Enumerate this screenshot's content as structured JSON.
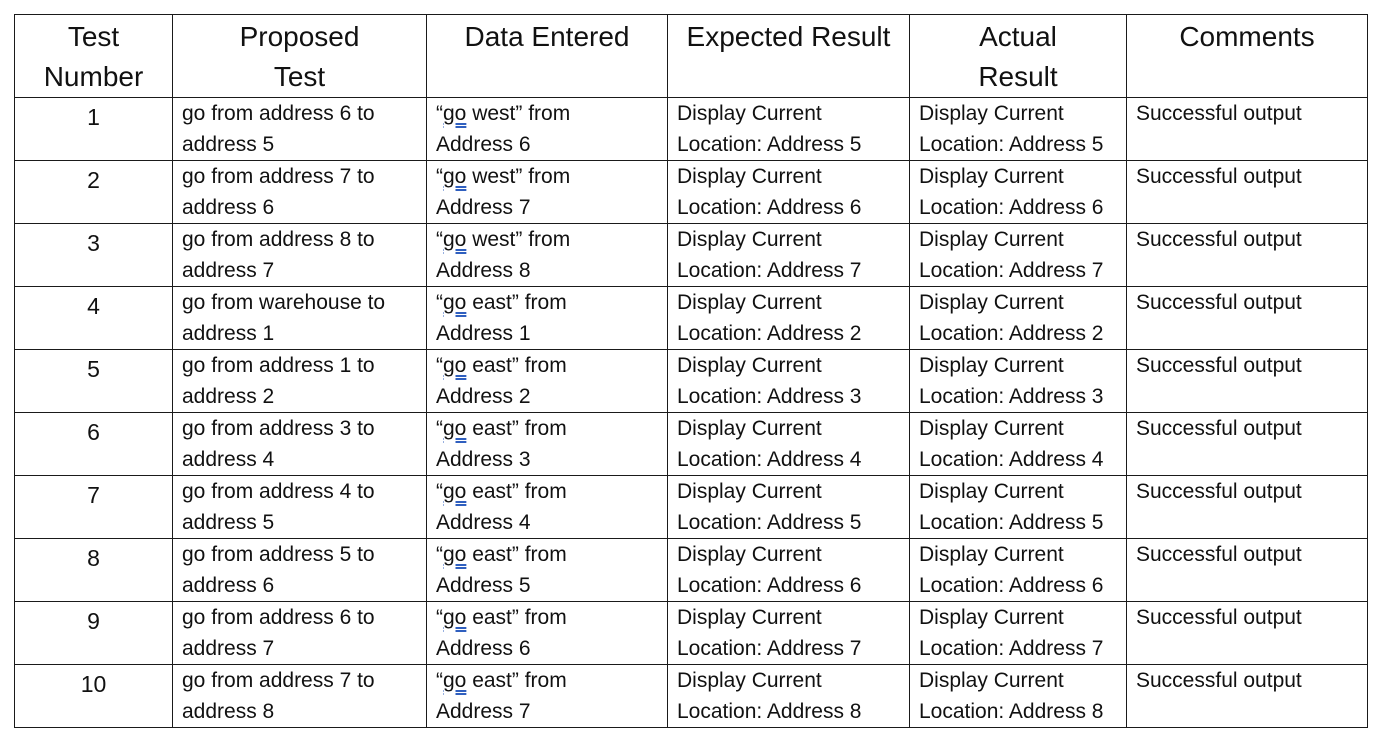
{
  "headers": {
    "test_number": [
      "Test",
      "Number"
    ],
    "proposed_test": [
      "Proposed",
      "Test"
    ],
    "data_entered": [
      "Data Entered"
    ],
    "expected_result": [
      "Expected Result"
    ],
    "actual_result": [
      "Actual",
      "Result"
    ],
    "comments": [
      "Comments"
    ]
  },
  "rows": [
    {
      "number": "1",
      "proposed": [
        "go from address 6 to",
        "address 5"
      ],
      "data": {
        "open": "“",
        "go": "go",
        "rest": " west” from",
        "line2": "Address 6"
      },
      "expected": [
        "Display Current",
        "Location: Address 5"
      ],
      "actual": [
        "Display Current",
        "Location: Address 5"
      ],
      "comment": "Successful output"
    },
    {
      "number": "2",
      "proposed": [
        "go from address 7 to",
        "address 6"
      ],
      "data": {
        "open": "“",
        "go": "go",
        "rest": " west” from",
        "line2": "Address 7"
      },
      "expected": [
        "Display Current",
        "Location: Address 6"
      ],
      "actual": [
        "Display Current",
        "Location: Address 6"
      ],
      "comment": "Successful output"
    },
    {
      "number": "3",
      "proposed": [
        "go from address 8 to",
        "address 7"
      ],
      "data": {
        "open": "“",
        "go": "go",
        "rest": " west” from",
        "line2": "Address 8"
      },
      "expected": [
        "Display Current",
        "Location: Address 7"
      ],
      "actual": [
        "Display Current",
        "Location: Address 7"
      ],
      "comment": "Successful output"
    },
    {
      "number": "4",
      "proposed": [
        "go from warehouse to",
        "address 1"
      ],
      "data": {
        "open": "“",
        "go": "go",
        "rest": " east” from",
        "line2": "Address 1"
      },
      "expected": [
        "Display Current",
        "Location: Address 2"
      ],
      "actual": [
        "Display Current",
        "Location: Address 2"
      ],
      "comment": "Successful output"
    },
    {
      "number": "5",
      "proposed": [
        "go from address 1 to",
        "address 2"
      ],
      "data": {
        "open": "“",
        "go": "go",
        "rest": " east” from",
        "line2": "Address 2"
      },
      "expected": [
        "Display Current",
        "Location: Address 3"
      ],
      "actual": [
        "Display Current",
        "Location: Address 3"
      ],
      "comment": "Successful output"
    },
    {
      "number": "6",
      "proposed": [
        "go from address 3 to",
        "address 4"
      ],
      "data": {
        "open": "“",
        "go": "go",
        "rest": " east” from",
        "line2": "Address 3"
      },
      "expected": [
        "Display Current",
        "Location: Address 4"
      ],
      "actual": [
        "Display Current",
        "Location: Address 4"
      ],
      "comment": "Successful output"
    },
    {
      "number": "7",
      "proposed": [
        "go from address 4 to",
        "address 5"
      ],
      "data": {
        "open": "“",
        "go": "go",
        "rest": " east” from",
        "line2": "Address 4"
      },
      "expected": [
        "Display Current",
        "Location: Address 5"
      ],
      "actual": [
        "Display Current",
        "Location: Address 5"
      ],
      "comment": "Successful output"
    },
    {
      "number": "8",
      "proposed": [
        "go from address 5 to",
        "address 6"
      ],
      "data": {
        "open": "“",
        "go": "go",
        "rest": " east” from",
        "line2": "Address 5"
      },
      "expected": [
        "Display Current",
        "Location: Address 6"
      ],
      "actual": [
        "Display Current",
        "Location: Address 6"
      ],
      "comment": "Successful output"
    },
    {
      "number": "9",
      "proposed": [
        "go from address 6 to",
        "address 7"
      ],
      "data": {
        "open": "“",
        "go": "go",
        "rest": " east” from",
        "line2": "Address 6"
      },
      "expected": [
        "Display Current",
        "Location: Address 7"
      ],
      "actual": [
        "Display Current",
        "Location: Address 7"
      ],
      "comment": "Successful output"
    },
    {
      "number": "10",
      "proposed": [
        "go from address 7 to",
        "address 8"
      ],
      "data": {
        "open": "“",
        "go": "go",
        "rest": " east” from",
        "line2": "Address 7"
      },
      "expected": [
        "Display Current",
        "Location: Address 8"
      ],
      "actual": [
        "Display Current",
        "Location: Address 8"
      ],
      "comment": "Successful output"
    }
  ],
  "colors": {
    "text": "#111111",
    "border": "#1a1a1a",
    "spellcheck_underline": "#2f5fbf"
  }
}
